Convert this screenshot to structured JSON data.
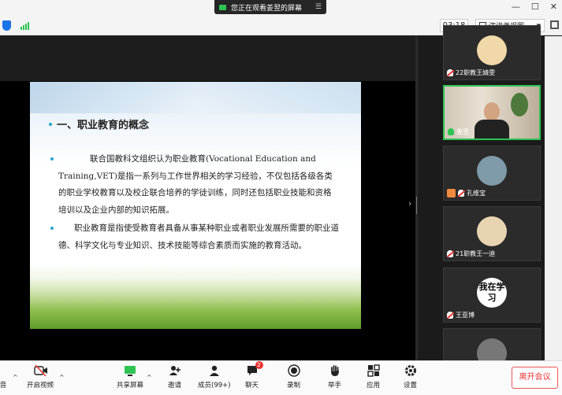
{
  "top": {
    "share_status": "您正在观看姜翌的屏幕",
    "timer": "03:18",
    "view_mode": "演讲者视图"
  },
  "slide": {
    "title": "一、职业教育的概念",
    "paragraphs": [
      "联合国教科文组织认为职业教育(Vocational Education and Training,VET)是指一系列与工作世界相关的学习经验，不仅包括各级各类的职业学校教育以及校企联合培养的学徒训练，同时还包括职业技能和资格培训以及企业内部的知识拓展。",
      "职业教育是指使受教育者具备从事某种职业或者职业发展所需要的职业道德、科学文化与专业知识、技术技能等综合素质而实施的教育活动。"
    ]
  },
  "participants": [
    {
      "name": "22职教王婧雯",
      "mic": "muted"
    },
    {
      "name": "姜翌",
      "mic": "active"
    },
    {
      "name": "孔维宝",
      "mic": "muted"
    },
    {
      "name": "21职教王一迪",
      "mic": "muted"
    },
    {
      "name": "王亚博",
      "mic": "muted",
      "avatar_text": "我在学习"
    },
    {
      "name": "",
      "mic": "muted"
    }
  ],
  "toolbar": {
    "audio": "音",
    "video": "开启视频",
    "share": "共享屏幕",
    "invite": "邀请",
    "members": "成员(99+)",
    "chat": "聊天",
    "chat_badge": "2",
    "record": "录制",
    "raise_hand": "举手",
    "apps": "应用",
    "settings": "设置",
    "leave": "离开会议"
  },
  "colors": {
    "accent_green": "#2ec353",
    "leave_red": "#e33333"
  }
}
